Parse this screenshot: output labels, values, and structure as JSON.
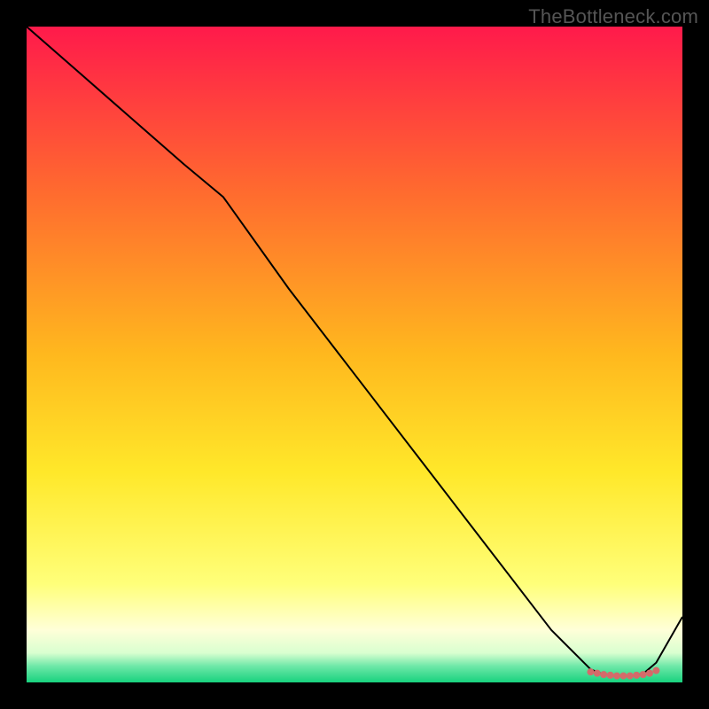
{
  "watermark": "TheBottleneck.com",
  "chart_data": {
    "type": "line",
    "title": "",
    "xlabel": "",
    "ylabel": "",
    "xlim": [
      0,
      100
    ],
    "ylim": [
      0,
      100
    ],
    "grid": false,
    "legend": false,
    "background_gradient": {
      "stops": [
        {
          "pos": 0.0,
          "color": "#ff1a4b"
        },
        {
          "pos": 0.25,
          "color": "#ff6a2f"
        },
        {
          "pos": 0.5,
          "color": "#ffb81e"
        },
        {
          "pos": 0.68,
          "color": "#ffe82a"
        },
        {
          "pos": 0.85,
          "color": "#ffff7a"
        },
        {
          "pos": 0.92,
          "color": "#ffffd8"
        },
        {
          "pos": 0.955,
          "color": "#d9ffd0"
        },
        {
          "pos": 0.975,
          "color": "#6fe8a8"
        },
        {
          "pos": 1.0,
          "color": "#18d27e"
        }
      ]
    },
    "series": [
      {
        "name": "curve",
        "type": "line",
        "color": "#000000",
        "width": 2,
        "x": [
          0,
          8,
          16,
          24,
          30,
          40,
          50,
          60,
          70,
          80,
          86,
          88,
          90,
          92,
          94,
          96,
          100
        ],
        "y": [
          100,
          93,
          86,
          79,
          74,
          60,
          47,
          34,
          21,
          8,
          2,
          1.2,
          1.0,
          1.0,
          1.3,
          3,
          10
        ]
      },
      {
        "name": "optimal-zone",
        "type": "marker-band",
        "color": "#d46a6a",
        "radius": 4,
        "x": [
          86,
          87,
          88,
          89,
          90,
          91,
          92,
          93,
          94,
          95,
          96
        ],
        "y": [
          1.6,
          1.4,
          1.2,
          1.1,
          1.0,
          1.0,
          1.0,
          1.1,
          1.2,
          1.4,
          1.8
        ]
      }
    ]
  }
}
